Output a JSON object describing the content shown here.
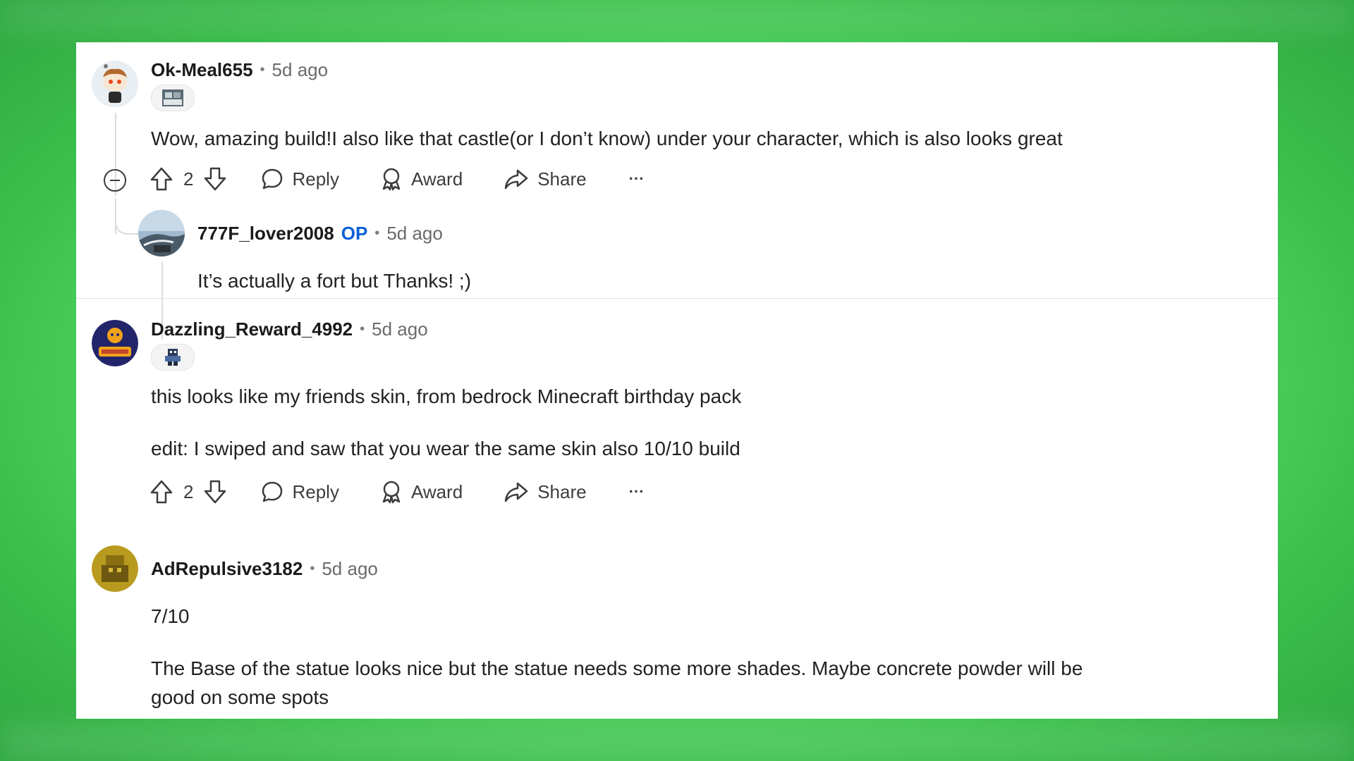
{
  "comments": [
    {
      "username": "Ok-Meal655",
      "time": "5d ago",
      "text": "Wow, amazing build!I also like that castle(or I don’t know) under your character, which is also looks great",
      "votes": "2",
      "reply_label": "Reply",
      "award_label": "Award",
      "share_label": "Share",
      "more_label": "···",
      "avatar_icon": "snoo-avatar-icon"
    },
    {
      "username": "777F_lover2008",
      "op_badge": "OP",
      "time": "5d ago",
      "text": "It’s actually a fort but Thanks! ;)",
      "avatar_icon": "car-photo-avatar"
    },
    {
      "username": "Dazzling_Reward_4992",
      "time": "5d ago",
      "text_line1": "this looks like my friends skin, from bedrock Minecraft birthday pack",
      "text_line2": "edit: I swiped and saw that you wear the same skin also 10/10 build",
      "votes": "2",
      "reply_label": "Reply",
      "award_label": "Award",
      "share_label": "Share",
      "more_label": "···",
      "avatar_icon": "game-character-avatar"
    },
    {
      "username": "AdRepulsive3182",
      "time": "5d ago",
      "text_line1": "7/10",
      "text_line2": "The Base of the statue looks nice but the statue needs some more shades. Maybe concrete powder will be",
      "text_line3": "good on some spots",
      "avatar_icon": "minecraft-block-avatar"
    }
  ],
  "colors": {
    "op": "#0a5fd6",
    "background_green": "#5fe06e",
    "panel": "#ffffff"
  }
}
